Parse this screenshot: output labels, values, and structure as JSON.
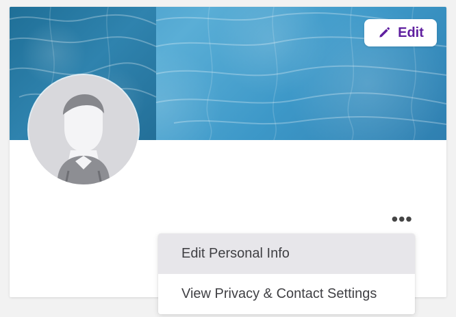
{
  "profile_card": {
    "cover_edit_label": "Edit",
    "more_label": "•••",
    "menu": [
      {
        "label": "Edit Personal Info"
      },
      {
        "label": "View Privacy & Contact Settings"
      }
    ]
  },
  "icons": {
    "edit": "pencil-icon",
    "avatar": "default-person-avatar",
    "more": "more-horizontal-icon"
  },
  "colors": {
    "accent": "#5f1f9f",
    "cover_primary": "#4aa3d2",
    "menu_highlight": "#e7e6ea"
  }
}
